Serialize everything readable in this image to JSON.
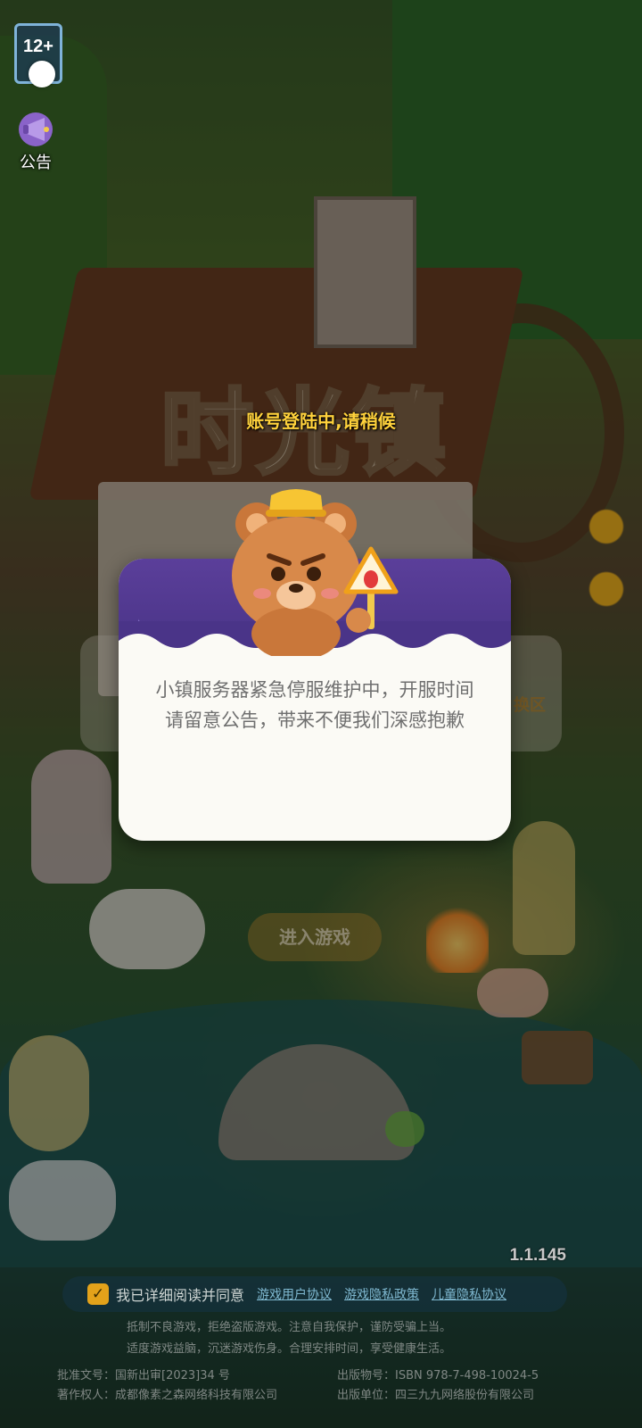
{
  "hud": {
    "age_rating": "12+",
    "notice_label": "公告"
  },
  "logo": {
    "text": "时光镇"
  },
  "login_status": "账号登陆中,请稍候",
  "dialog": {
    "message": "小镇服务器紧急停服维护中，开服时间请留意公告，带来不便我们深感抱歉"
  },
  "background_ui": {
    "switch_server_label": "换区",
    "enter_game_label": "进入游戏"
  },
  "version": "1.1.145",
  "agreement": {
    "checked": true,
    "text": "我已详细阅读并同意",
    "links": [
      "游戏用户协议",
      "游戏隐私政策",
      "儿童隐私协议"
    ]
  },
  "health_notice": {
    "line1": "抵制不良游戏，拒绝盗版游戏。注意自我保护，谨防受骗上当。",
    "line2": "适度游戏益脑，沉迷游戏伤身。合理安排时间，享受健康生活。"
  },
  "publication": {
    "approval": "批准文号：国新出审[2023]34 号",
    "publication_no": "出版物号：ISBN 978-7-498-10024-5",
    "copyright": "著作权人：成都像素之森网络科技有限公司",
    "publisher": "出版单位：四三九九网络股份有限公司"
  },
  "colors": {
    "dialog_header": "#4a3488",
    "status_text": "#ffd23c",
    "checkbox": "#e3a21a",
    "link": "#7fb8d0"
  }
}
